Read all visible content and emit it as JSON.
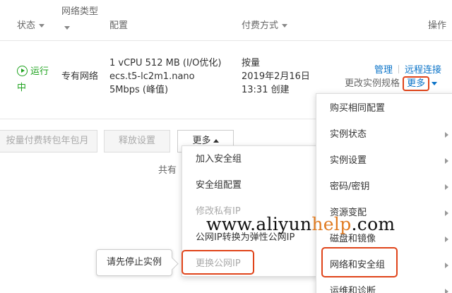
{
  "table": {
    "headers": {
      "status": "状态",
      "network_type": "网络类型",
      "config": "配置",
      "payment": "付费方式",
      "actions": "操作"
    },
    "row": {
      "status": "运行",
      "status_cont": "中",
      "network": "专有网络",
      "config_line1": "1 vCPU 512 MB (I/O优化)",
      "config_line2": "ecs.t5-lc2m1.nano",
      "config_line3": "5Mbps (峰值)",
      "payment_line1": "按量",
      "payment_line2": "2019年2月16日",
      "payment_line3": "13:31 创建",
      "action_manage": "管理",
      "action_remote": "远程连接",
      "action_change_spec": "更改实例规格",
      "action_more": "更多"
    }
  },
  "bulk": {
    "convert_button": "按量付费转包年包月",
    "release_button": "释放设置",
    "more_button": "更多",
    "total_text": "共有"
  },
  "left_menu": {
    "items": [
      {
        "label": "加入安全组",
        "disabled": false
      },
      {
        "label": "安全组配置",
        "disabled": false
      },
      {
        "label": "修改私有IP",
        "disabled": true
      },
      {
        "label": "公网IP转换为弹性公网IP",
        "disabled": false
      },
      {
        "label": "更换公网IP",
        "disabled": true
      }
    ]
  },
  "right_menu": {
    "items": [
      {
        "label": "购买相同配置",
        "has_submenu": false
      },
      {
        "label": "实例状态",
        "has_submenu": true
      },
      {
        "label": "实例设置",
        "has_submenu": true
      },
      {
        "label": "密码/密钥",
        "has_submenu": true
      },
      {
        "label": "资源变配",
        "has_submenu": true
      },
      {
        "label": "磁盘和镜像",
        "has_submenu": true
      },
      {
        "label": "网络和安全组",
        "has_submenu": true
      },
      {
        "label": "运维和诊断",
        "has_submenu": true
      }
    ]
  },
  "tooltip": {
    "text": "请先停止实例"
  },
  "watermark": {
    "prefix": "www.aliyun",
    "accent": "help",
    "suffix": ".com"
  },
  "colors": {
    "link": "#0a73c8",
    "running": "#1fa31f",
    "highlight": "#e0441a",
    "watermark_accent": "#e07b22"
  }
}
